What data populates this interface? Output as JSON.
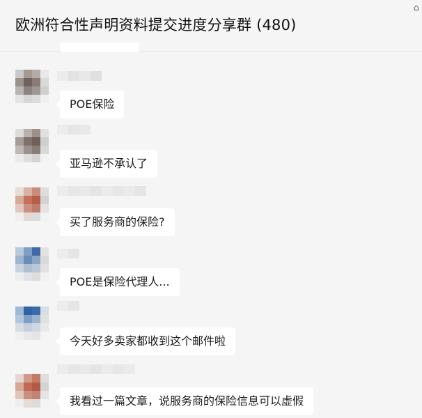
{
  "header": {
    "title": "欧洲符合性声明资料提交进度分享群 (480)",
    "corner_icon": "pin-icon"
  },
  "messages": [
    {
      "text": "POE保险"
    },
    {
      "text": "亚马逊不承认了"
    },
    {
      "text": "买了服务商的保险?"
    },
    {
      "text": "POE是保险代理人..."
    },
    {
      "text": "今天好多卖家都收到这个邮件啦"
    },
    {
      "text": "我看过一篇文章，说服务商的保险信息可以虚假"
    }
  ],
  "colors": {
    "background": "#f5f5f5",
    "bubble": "#ffffff",
    "text": "#1a1a1a"
  }
}
